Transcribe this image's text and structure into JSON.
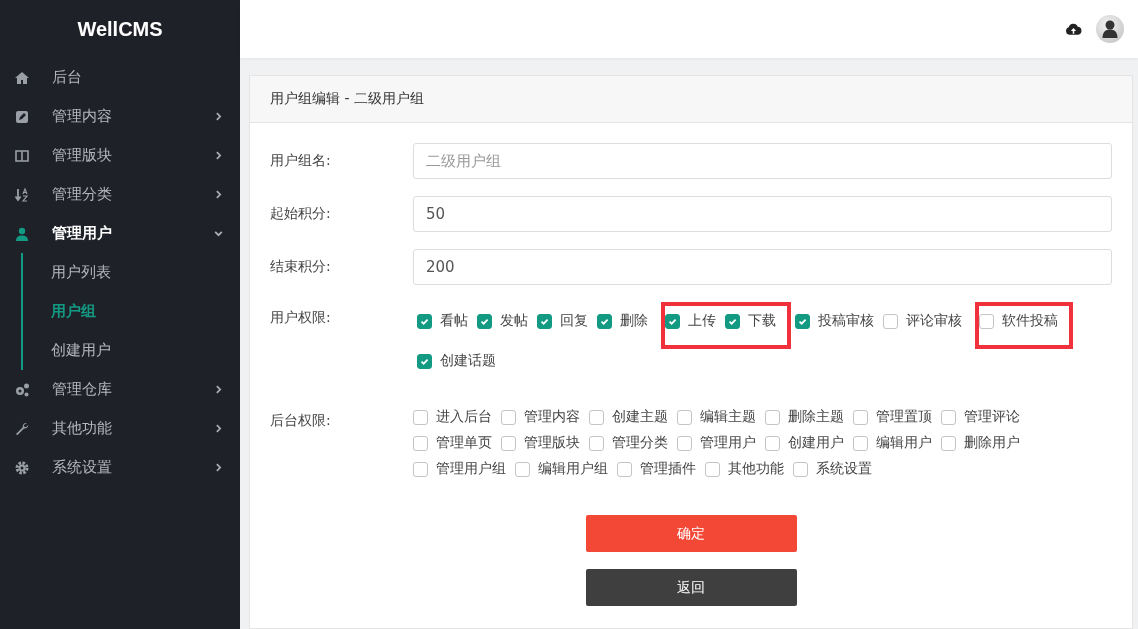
{
  "brand": "WellCMS",
  "sidebar": {
    "items": [
      {
        "label": "后台",
        "selected": false
      },
      {
        "label": "管理内容",
        "expanded": false,
        "selected": false
      },
      {
        "label": "管理版块",
        "expanded": false,
        "selected": false
      },
      {
        "label": "管理分类",
        "expanded": false,
        "selected": false
      },
      {
        "label": "管理用户",
        "expanded": true,
        "selected": true,
        "children": [
          {
            "label": "用户列表",
            "selected": false
          },
          {
            "label": "用户组",
            "selected": true
          },
          {
            "label": "创建用户",
            "selected": false
          }
        ]
      },
      {
        "label": "管理仓库",
        "expanded": false,
        "selected": false
      },
      {
        "label": "其他功能",
        "expanded": false,
        "selected": false
      },
      {
        "label": "系统设置",
        "expanded": false,
        "selected": false
      }
    ]
  },
  "card_title": "用户组编辑 - 二级用户组",
  "fields": [
    {
      "label": "用户组名:",
      "placeholder": "二级用户组"
    },
    {
      "label": "起始积分:",
      "value": "50"
    },
    {
      "label": "结束积分:",
      "value": "200"
    }
  ],
  "user_permissions": {
    "label": "用户权限:",
    "items": [
      {
        "label": "看帖",
        "checked": true,
        "highlighted": false
      },
      {
        "label": "发帖",
        "checked": true,
        "highlighted": false
      },
      {
        "label": "回复",
        "checked": true,
        "highlighted": false
      },
      {
        "label": "删除",
        "checked": true,
        "highlighted": false
      },
      {
        "label": "上传",
        "checked": true,
        "highlighted": true
      },
      {
        "label": "下载",
        "checked": true,
        "highlighted": true
      },
      {
        "label": "投稿审核",
        "checked": true,
        "highlighted": false
      },
      {
        "label": "评论审核",
        "checked": false,
        "highlighted": false
      },
      {
        "label": "软件投稿",
        "checked": false,
        "highlighted": true
      },
      {
        "label": "创建话题",
        "checked": true,
        "highlighted": false
      }
    ]
  },
  "admin_permissions": {
    "label": "后台权限:",
    "items": [
      {
        "label": "进入后台",
        "checked": false
      },
      {
        "label": "管理内容",
        "checked": false
      },
      {
        "label": "创建主题",
        "checked": false
      },
      {
        "label": "编辑主题",
        "checked": false
      },
      {
        "label": "删除主题",
        "checked": false
      },
      {
        "label": "管理置顶",
        "checked": false
      },
      {
        "label": "管理评论",
        "checked": false
      },
      {
        "label": "管理单页",
        "checked": false
      },
      {
        "label": "管理版块",
        "checked": false
      },
      {
        "label": "管理分类",
        "checked": false
      },
      {
        "label": "管理用户",
        "checked": false
      },
      {
        "label": "创建用户",
        "checked": false
      },
      {
        "label": "编辑用户",
        "checked": false
      },
      {
        "label": "删除用户",
        "checked": false
      },
      {
        "label": "管理用户组",
        "checked": false
      },
      {
        "label": "编辑用户组",
        "checked": false
      },
      {
        "label": "管理插件",
        "checked": false
      },
      {
        "label": "其他功能",
        "checked": false
      },
      {
        "label": "系统设置",
        "checked": false
      }
    ]
  },
  "buttons": [
    {
      "kind": "primary",
      "label": "确定"
    },
    {
      "kind": "secondary",
      "label": "返回"
    }
  ]
}
